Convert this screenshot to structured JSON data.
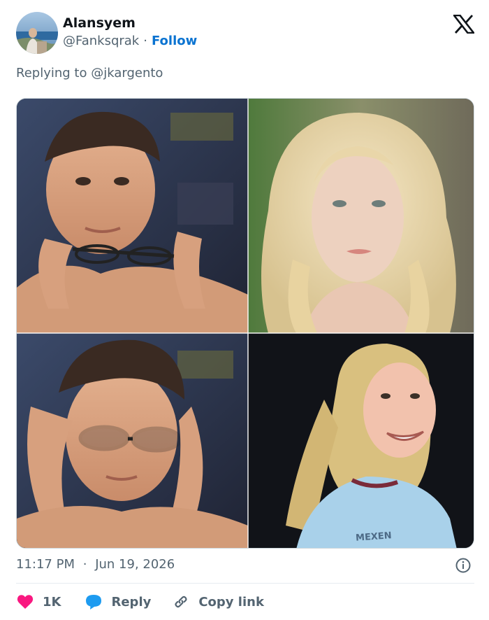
{
  "author": {
    "name": "Alansyem",
    "handle": "@Fanksqrak",
    "separator": "·",
    "follow_label": "Follow",
    "avatar_icon": "avatar-photo"
  },
  "brand": {
    "icon": "x-logo-icon",
    "color": "#0f1419"
  },
  "reply_context": {
    "prefix": "Replying to",
    "handle": "@jkargento"
  },
  "media": {
    "alt": "Four-panel meme image",
    "jersey_text": "MEXEN"
  },
  "meta": {
    "time": "11:17 PM",
    "separator": "·",
    "date": "Jun 19, 2026",
    "info_icon": "info-icon"
  },
  "actions": {
    "like_count": "1K",
    "like_icon": "heart-icon",
    "reply_label": "Reply",
    "reply_icon": "speech-bubble-icon",
    "copy_label": "Copy link",
    "copy_icon": "link-icon"
  },
  "colors": {
    "accent": "#0a73d1",
    "like": "#f91880",
    "reply": "#1d9bf0",
    "muted": "#536471"
  }
}
